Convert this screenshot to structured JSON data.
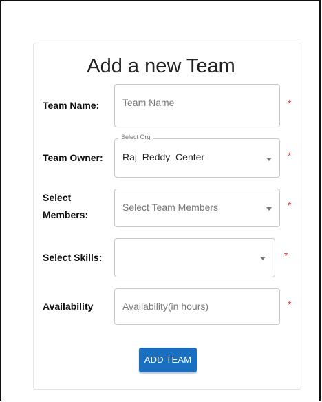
{
  "form": {
    "title": "Add a new Team",
    "team_name": {
      "label": "Team Name:",
      "placeholder": "Team Name",
      "required_mark": "*"
    },
    "team_owner": {
      "label": "Team Owner:",
      "floating_label": "Select Org",
      "value": "Raj_Reddy_Center",
      "required_mark": "*"
    },
    "members": {
      "label_line1": "Select",
      "label_line2": "Members:",
      "placeholder": "Select Team Members",
      "required_mark": "*"
    },
    "skills": {
      "label": "Select Skills:",
      "value": "",
      "required_mark": "*"
    },
    "availability": {
      "label": "Availability",
      "placeholder": "Availability(in hours)",
      "required_mark": "*"
    },
    "submit_label": "ADD TEAM"
  },
  "colors": {
    "primary": "#1a6fc0",
    "required": "#e03030"
  },
  "icons": {
    "dropdown": "chevron-down-icon"
  }
}
